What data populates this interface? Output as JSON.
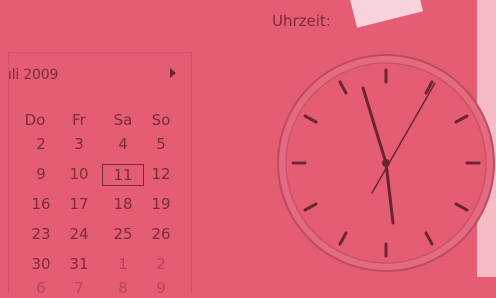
{
  "time_label": "Uhrzeit:",
  "calendar": {
    "month_label": "ıli 2009",
    "weekday_headers": [
      "Do",
      "Fr",
      "Sa",
      "So"
    ],
    "rows": [
      [
        "2",
        "3",
        "4",
        "5"
      ],
      [
        "9",
        "10",
        "11",
        "12"
      ],
      [
        "16",
        "17",
        "18",
        "19"
      ],
      [
        "23",
        "24",
        "25",
        "26"
      ],
      [
        "30",
        "31",
        "1",
        "2"
      ],
      [
        "6",
        "7",
        "8",
        "9"
      ]
    ],
    "selected_day": "11",
    "nav_next_icon": "chevron-right-icon"
  },
  "colors": {
    "overlay": "#e55d73",
    "text": "#7a2c3a",
    "highlight": "#f5bcc6"
  }
}
